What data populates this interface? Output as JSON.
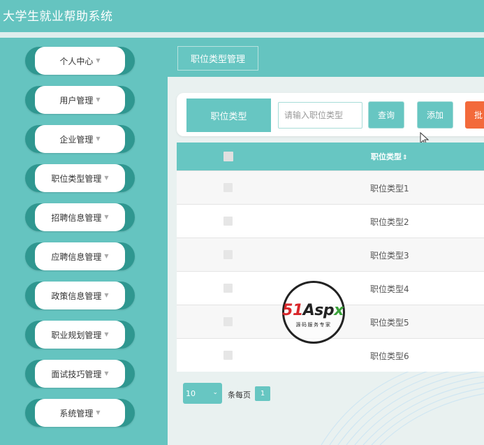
{
  "app": {
    "title": "大学生就业帮助系统"
  },
  "sidebar": {
    "items": [
      {
        "label": "个人中心"
      },
      {
        "label": "用户管理"
      },
      {
        "label": "企业管理"
      },
      {
        "label": "职位类型管理"
      },
      {
        "label": "招聘信息管理"
      },
      {
        "label": "应聘信息管理"
      },
      {
        "label": "政策信息管理"
      },
      {
        "label": "职业规划管理"
      },
      {
        "label": "面试技巧管理"
      },
      {
        "label": "系统管理"
      }
    ]
  },
  "page": {
    "breadcrumb": "职位类型管理"
  },
  "search": {
    "label": "职位类型",
    "placeholder": "请输入职位类型",
    "query_label": "查询",
    "add_label": "添加",
    "batch_label": "批"
  },
  "table": {
    "header": "职位类型",
    "rows": [
      {
        "name": "职位类型1"
      },
      {
        "name": "职位类型2"
      },
      {
        "name": "职位类型3"
      },
      {
        "name": "职位类型4"
      },
      {
        "name": "职位类型5"
      },
      {
        "name": "职位类型6"
      }
    ]
  },
  "pager": {
    "page_size": "10",
    "page_size_suffix": "条每页",
    "current_page": "1"
  },
  "watermark": {
    "brand_a": "51",
    "brand_b": "Asp",
    "brand_c": "x",
    "subtitle": "源码服务专家"
  },
  "colors": {
    "accent": "#67c6c2",
    "accent_dark": "#2f9790",
    "danger": "#f36a3b"
  }
}
